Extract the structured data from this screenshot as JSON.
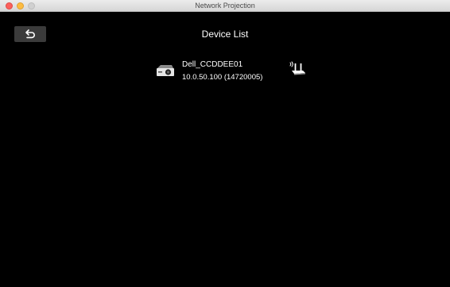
{
  "window": {
    "title": "Network Projection"
  },
  "header": {
    "back_icon": "undo-arrow-icon",
    "title": "Device List"
  },
  "devices": [
    {
      "icon": "projector-icon",
      "name": "Dell_CCDDEE01",
      "address": "10.0.50.100 (14720005)",
      "connection_icon": "wireless-router-icon"
    }
  ],
  "colors": {
    "background": "#000000",
    "text": "#ffffff",
    "back_button": "#3b3b3b"
  }
}
